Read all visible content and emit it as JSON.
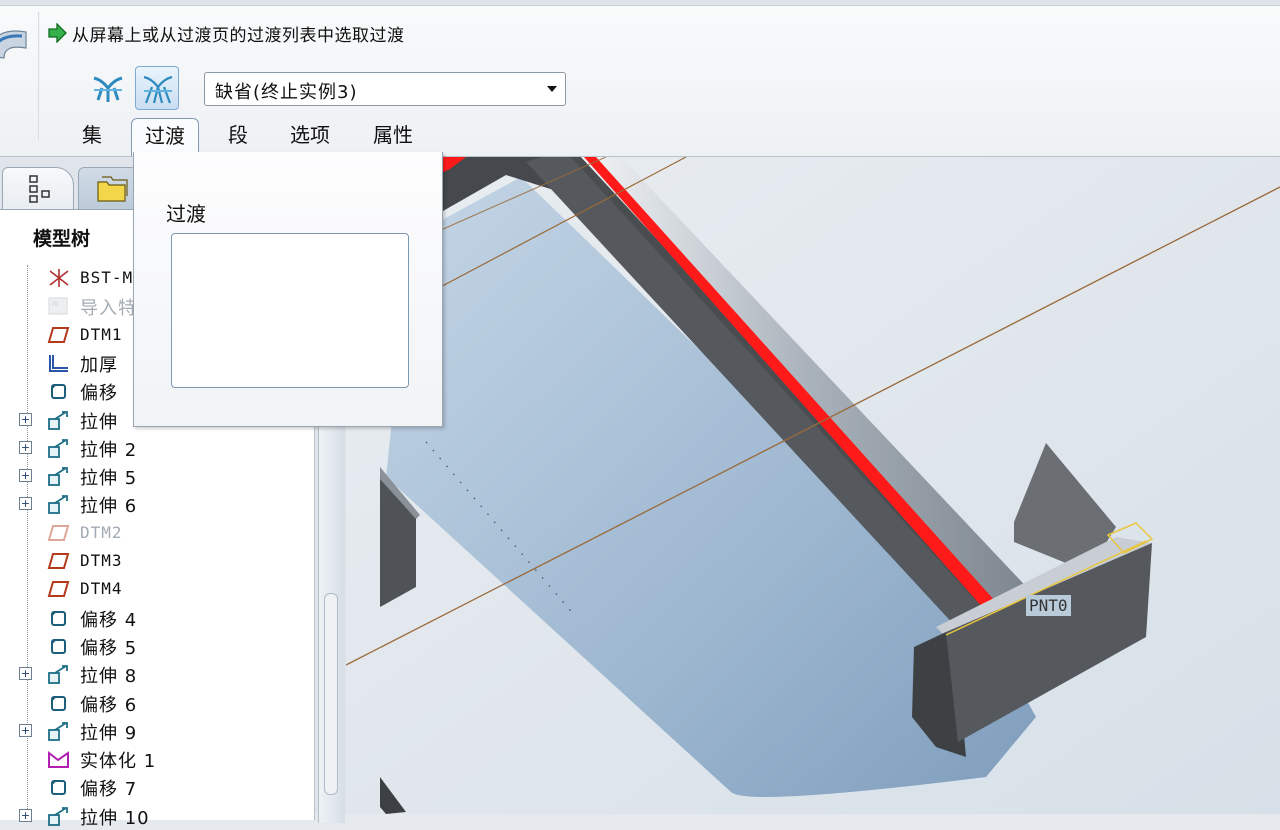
{
  "dashboard": {
    "prompt": "从屏幕上或从过渡页的过渡列表中选取过渡",
    "tools": [
      {
        "name": "single-transition-tool",
        "icon": "transition-single-icon"
      },
      {
        "name": "multi-transition-tool",
        "icon": "transition-multi-icon",
        "active": true
      }
    ],
    "transition_select": {
      "value": "缺省(终止实例3)"
    },
    "tabs": [
      {
        "label": "集"
      },
      {
        "label": "过渡",
        "active": true
      },
      {
        "label": "段"
      },
      {
        "label": "选项"
      },
      {
        "label": "属性"
      }
    ]
  },
  "transitions_panel": {
    "label": "过渡",
    "items": []
  },
  "navigator": {
    "title": "模型树",
    "tabs": [
      {
        "icon": "model-tree-icon"
      },
      {
        "icon": "folder-browser-icon"
      }
    ],
    "tree": [
      {
        "label": "BST-M",
        "icon": "coordinate-system-icon"
      },
      {
        "label": "导入特",
        "icon": "import-feature-icon",
        "dim": true
      },
      {
        "label": "DTM1",
        "icon": "datum-plane-icon"
      },
      {
        "label": "加厚",
        "icon": "thicken-icon"
      },
      {
        "label": "偏移",
        "icon": "offset-icon"
      },
      {
        "label": "拉伸",
        "icon": "extrude-icon",
        "expandable": true
      },
      {
        "label": "拉伸 2",
        "icon": "extrude-icon",
        "expandable": true
      },
      {
        "label": "拉伸 5",
        "icon": "extrude-icon",
        "expandable": true
      },
      {
        "label": "拉伸 6",
        "icon": "extrude-icon",
        "expandable": true
      },
      {
        "label": "DTM2",
        "icon": "datum-plane-icon",
        "dim": true
      },
      {
        "label": "DTM3",
        "icon": "datum-plane-icon"
      },
      {
        "label": "DTM4",
        "icon": "datum-plane-icon"
      },
      {
        "label": "偏移 4",
        "icon": "offset-icon"
      },
      {
        "label": "偏移 5",
        "icon": "offset-icon"
      },
      {
        "label": "拉伸 8",
        "icon": "extrude-icon",
        "expandable": true
      },
      {
        "label": "偏移 6",
        "icon": "offset-icon"
      },
      {
        "label": "拉伸 9",
        "icon": "extrude-icon",
        "expandable": true
      },
      {
        "label": "实体化 1",
        "icon": "solidify-icon"
      },
      {
        "label": "偏移 7",
        "icon": "offset-icon"
      },
      {
        "label": "拉伸 10",
        "icon": "extrude-icon",
        "expandable": true
      }
    ]
  },
  "graphics": {
    "datum_point_label": "PNT0",
    "colors": {
      "selected_edge": "#ff1a1a",
      "part_surface": "#9fb8cf",
      "rib_side": "#4a4d50",
      "datum_curve": "#9a6a3a",
      "background": "#dfe6ec"
    }
  }
}
